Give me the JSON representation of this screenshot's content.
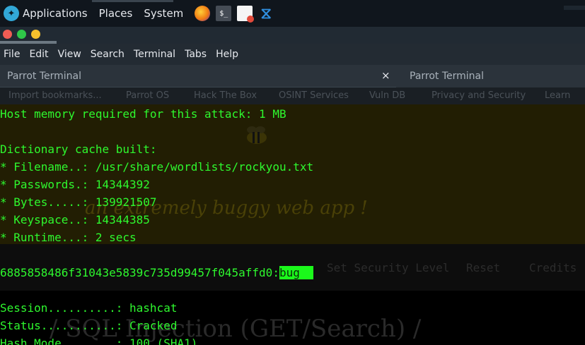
{
  "taskbar": {
    "menus": [
      "Applications",
      "Places",
      "System"
    ],
    "launchers": [
      "firefox-icon",
      "terminal-icon",
      "text-editor-icon",
      "vscode-icon"
    ],
    "terminal_glyph": "$_"
  },
  "window": {
    "menu": [
      "File",
      "Edit",
      "View",
      "Search",
      "Terminal",
      "Tabs",
      "Help"
    ],
    "tabs": [
      {
        "label": "Parrot Terminal"
      },
      {
        "label": "Parrot Terminal"
      }
    ],
    "close_glyph": "×"
  },
  "bookmarks": [
    "Import bookmarks...",
    "Parrot OS",
    "Hack The Box",
    "OSINT Services",
    "Vuln DB",
    "Privacy and Security",
    "Learn"
  ],
  "background_page": {
    "tagline": "an extremely buggy web app !",
    "nav": [
      "Set Security Level",
      "Reset",
      "Credits"
    ],
    "heading": "/ SQL Injection (GET/Search) /"
  },
  "terminal": {
    "lines": [
      "Host memory required for this attack: 1 MB",
      "",
      "Dictionary cache built:",
      "* Filename..: /usr/share/wordlists/rockyou.txt",
      "* Passwords.: 14344392",
      "* Bytes.....: 139921507",
      "* Keyspace..: 14344385",
      "* Runtime...: 2 secs",
      ""
    ],
    "hash": "6885858486f31043e5839c735d99457f045affd0:",
    "cracked": "bug",
    "status_lines": [
      "Session..........: hashcat",
      "Status...........: Cracked",
      "Hash.Mode........: 100 (SHA1)"
    ]
  },
  "colors": {
    "terminal_text": "#2ef82e",
    "highlight": "#1bf81b",
    "panel": "#10161d"
  }
}
